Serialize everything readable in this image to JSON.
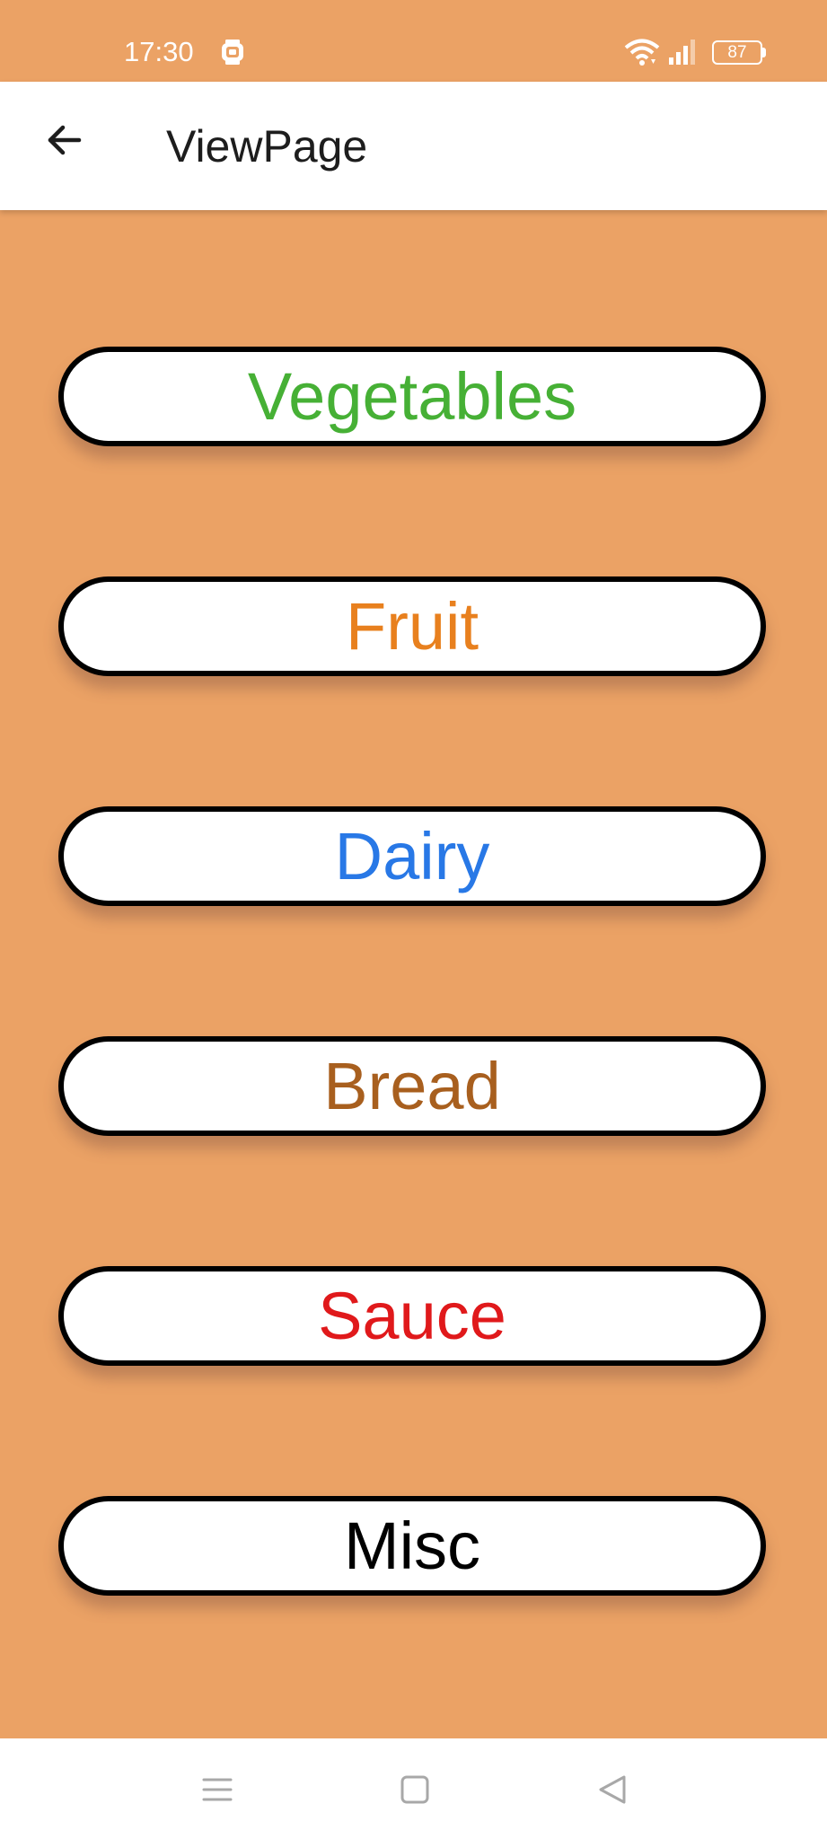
{
  "status_bar": {
    "time": "17:30",
    "battery_level": "87",
    "icons": [
      "watch-icon",
      "wifi-icon",
      "signal-icon",
      "battery-icon"
    ]
  },
  "app_bar": {
    "back_icon": "arrow-left-icon",
    "title": "ViewPage"
  },
  "categories": [
    {
      "label": "Vegetables",
      "color": "#46B035"
    },
    {
      "label": "Fruit",
      "color": "#E8801E"
    },
    {
      "label": "Dairy",
      "color": "#2878E6"
    },
    {
      "label": "Bread",
      "color": "#A85F1E"
    },
    {
      "label": "Sauce",
      "color": "#E0191B"
    },
    {
      "label": "Misc",
      "color": "#000000"
    }
  ],
  "nav_bar": {
    "icons": [
      "menu-icon",
      "home-icon",
      "back-triangle-icon"
    ]
  },
  "colors": {
    "background": "#EBA265",
    "app_bar": "#FFFFFF",
    "button_border": "#000000"
  }
}
